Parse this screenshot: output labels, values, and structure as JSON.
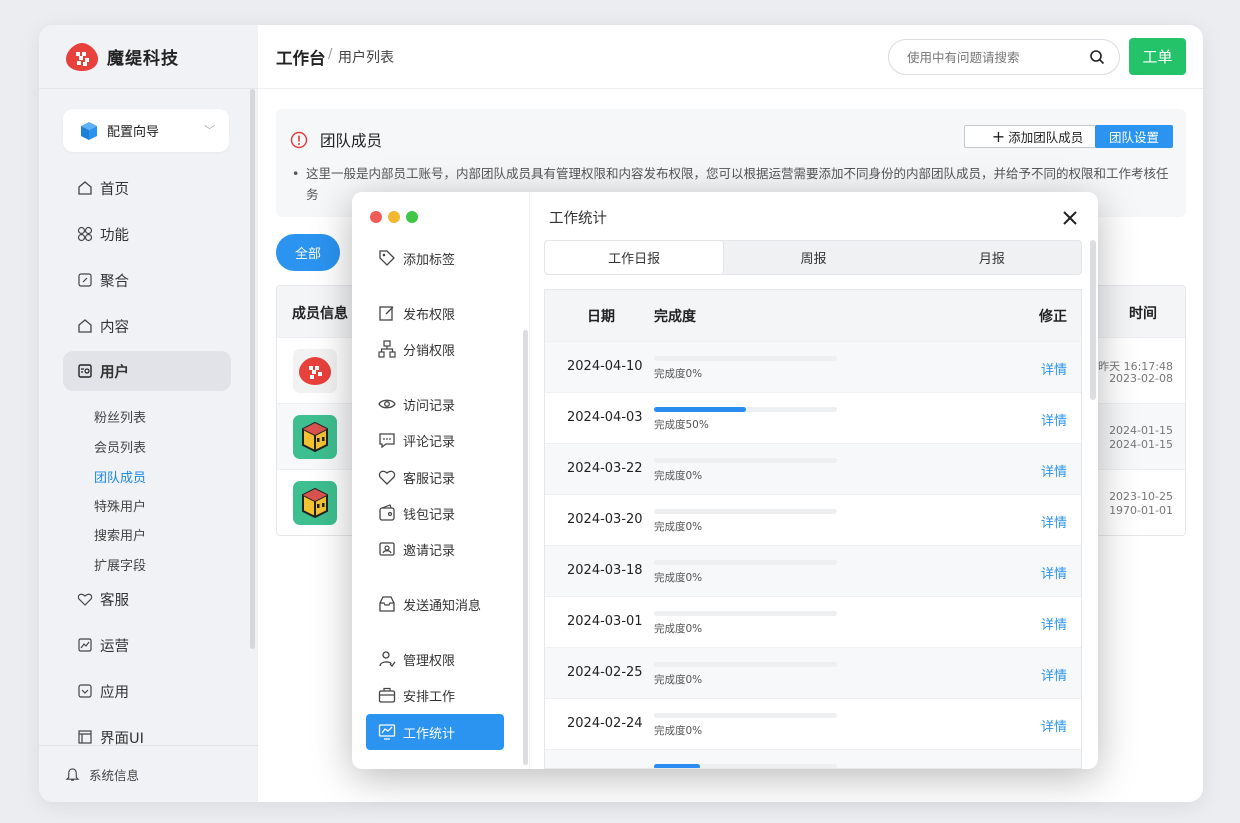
{
  "app": {
    "brand": "魔缇科技",
    "accent": "#2b93f0",
    "green": "#24c269"
  },
  "sidebar": {
    "config_label": "配置向导",
    "items": [
      {
        "label": "首页",
        "icon": "home-icon"
      },
      {
        "label": "功能",
        "icon": "grid-icon"
      },
      {
        "label": "聚合",
        "icon": "aggregate-icon"
      },
      {
        "label": "内容",
        "icon": "content-icon"
      },
      {
        "label": "用户",
        "icon": "user-card-icon"
      },
      {
        "label": "客服",
        "icon": "heart-icon"
      },
      {
        "label": "运营",
        "icon": "chart-icon"
      },
      {
        "label": "应用",
        "icon": "app-icon"
      },
      {
        "label": "界面UI",
        "icon": "layout-icon"
      }
    ],
    "subitems": [
      "粉丝列表",
      "会员列表",
      "团队成员",
      "特殊用户",
      "搜索用户",
      "扩展字段"
    ],
    "system_info": "系统信息"
  },
  "header": {
    "breadcrumb_root": "工作台",
    "breadcrumb_sep": "/",
    "breadcrumb_current": "用户列表",
    "search_placeholder": "使用中有问题请搜索",
    "ticket_label": "工单"
  },
  "notice": {
    "title": "团队成员",
    "description": "这里一般是内部员工账号，内部团队成员具有管理权限和内容发布权限，您可以根据运营需要添加不同身份的内部团队成员，并给予不同的权限和工作考核任务",
    "add_button": "添加团队成员",
    "settings_button": "团队设置"
  },
  "filter": {
    "all_label": "全部"
  },
  "table": {
    "col_member": "成员信息",
    "col_time": "时间",
    "rows": [
      {
        "time1": "昨天 16:17:48",
        "time2": "2023-02-08"
      },
      {
        "time1": "2024-01-15",
        "time2": "2024-01-15"
      },
      {
        "time1": "2023-10-25",
        "time2": "1970-01-01"
      }
    ]
  },
  "modal": {
    "title": "工作统计",
    "menu": [
      {
        "label": "添加标签",
        "icon": "tag-icon"
      },
      {
        "label": "发布权限",
        "icon": "edit-icon"
      },
      {
        "label": "分销权限",
        "icon": "distribution-icon"
      },
      {
        "label": "访问记录",
        "icon": "eye-icon"
      },
      {
        "label": "评论记录",
        "icon": "comment-icon"
      },
      {
        "label": "客服记录",
        "icon": "heart-icon"
      },
      {
        "label": "钱包记录",
        "icon": "wallet-icon"
      },
      {
        "label": "邀请记录",
        "icon": "invite-icon"
      },
      {
        "label": "发送通知消息",
        "icon": "inbox-icon"
      },
      {
        "label": "管理权限",
        "icon": "admin-icon"
      },
      {
        "label": "安排工作",
        "icon": "briefcase-icon"
      },
      {
        "label": "工作统计",
        "icon": "monitor-icon"
      }
    ],
    "tabs": [
      "工作日报",
      "周报",
      "月报"
    ],
    "columns": {
      "date": "日期",
      "progress": "完成度",
      "fix": "修正"
    },
    "rows": [
      {
        "date": "2024-04-10",
        "progress": 0,
        "label": "完成度0%",
        "link": "详情"
      },
      {
        "date": "2024-04-03",
        "progress": 50,
        "label": "完成度50%",
        "link": "详情"
      },
      {
        "date": "2024-03-22",
        "progress": 0,
        "label": "完成度0%",
        "link": "详情"
      },
      {
        "date": "2024-03-20",
        "progress": 0,
        "label": "完成度0%",
        "link": "详情"
      },
      {
        "date": "2024-03-18",
        "progress": 0,
        "label": "完成度0%",
        "link": "详情"
      },
      {
        "date": "2024-03-01",
        "progress": 0,
        "label": "完成度0%",
        "link": "详情"
      },
      {
        "date": "2024-02-25",
        "progress": 0,
        "label": "完成度0%",
        "link": "详情"
      },
      {
        "date": "2024-02-24",
        "progress": 0,
        "label": "完成度0%",
        "link": "详情"
      },
      {
        "date": "",
        "progress": 25,
        "label": "",
        "link": ""
      }
    ]
  }
}
